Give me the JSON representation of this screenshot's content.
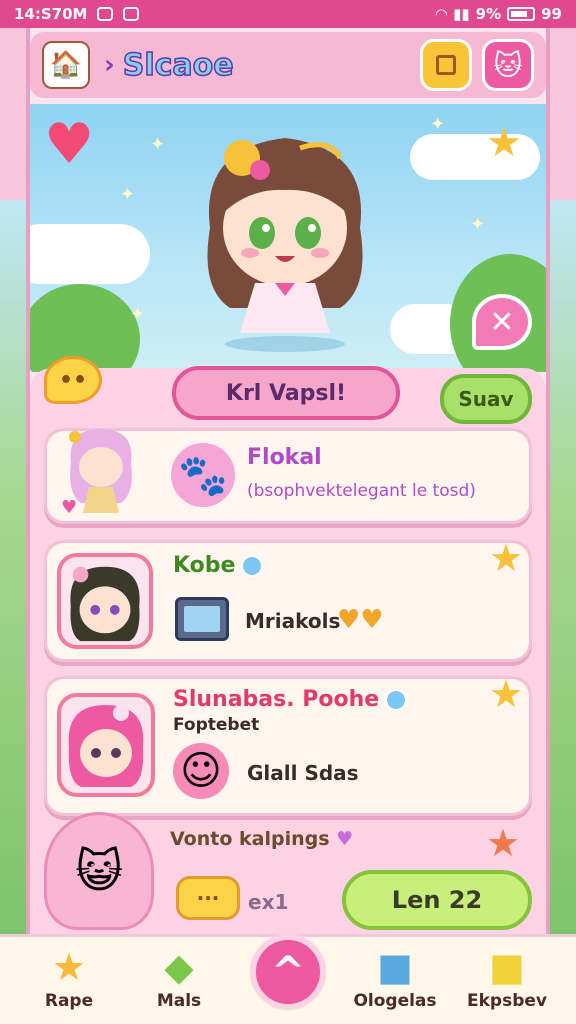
{
  "status_bar": {
    "time": "14:S70M",
    "battery": "9%",
    "signal_text": "99"
  },
  "header": {
    "title": "Slcaoe",
    "logo_icon": "house-icon",
    "square_button_icon": "square-icon",
    "cat_button_icon": "cat-icon"
  },
  "hero": {
    "close_icon": "close-icon"
  },
  "panel": {
    "banner": "Krl Vapsl!",
    "save_label": "Suav",
    "chat_icon": "chat-bubble-icon"
  },
  "cards": [
    {
      "name": "Flokal",
      "subtitle": "(bsophvektelegant le tosd)"
    },
    {
      "name": "Kobe",
      "detail": "Mriakols",
      "hearts": "♥♥"
    },
    {
      "name": "Slunabas. Poohe",
      "subtitle": "Foptebet",
      "detail": "Glall Sdas"
    },
    {
      "name": "Vonto kalpings",
      "count": "ex1",
      "level_label": "Len 22"
    }
  ],
  "bottom_nav": {
    "items": [
      {
        "label": "Rape",
        "icon": "star-icon"
      },
      {
        "label": "Mals",
        "icon": "map-icon"
      },
      {
        "label": "Ologelas",
        "icon": "shop-icon"
      },
      {
        "label": "Ekpsbev",
        "icon": "box-icon"
      }
    ],
    "center_icon": "up-arrow-icon"
  },
  "colors": {
    "accent": "#ee5aa2",
    "panel_bg": "#fbd3e4",
    "card_bg": "#fff6f0",
    "green": "#a8e06a",
    "yellow": "#fbd346"
  }
}
